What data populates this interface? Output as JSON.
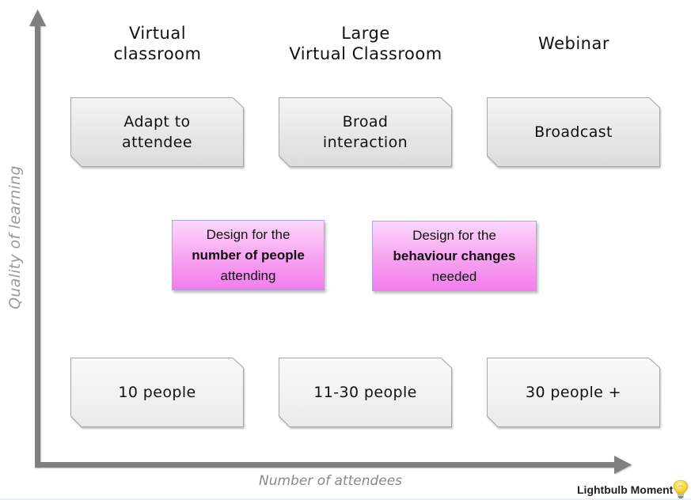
{
  "axes": {
    "y_label": "Quality of learning",
    "x_label": "Number of attendees",
    "axis_color": "#7f7f7f"
  },
  "columns": [
    {
      "title": "Virtual\nclassroom",
      "title_lines": [
        "Virtual",
        "classroom"
      ],
      "quality": "Adapt to\nattendee",
      "quality_lines": [
        "Adapt to",
        "attendee"
      ],
      "attendees": "10 people"
    },
    {
      "title": "Large Virtual Classroom",
      "title_lines": [
        "Large",
        "Virtual Classroom"
      ],
      "quality": "Broad interaction",
      "quality_lines": [
        "Broad",
        "interaction"
      ],
      "attendees": "11-30 people"
    },
    {
      "title": "Webinar",
      "title_lines": [
        "Webinar"
      ],
      "quality": "Broadcast",
      "quality_lines": [
        "Broadcast"
      ],
      "attendees": "30 people +"
    }
  ],
  "callouts": [
    {
      "line1": "Design for the",
      "bold": "number of people",
      "line3": "attending"
    },
    {
      "line1": "Design for the",
      "bold": "behaviour changes",
      "line3": "needed"
    }
  ],
  "brand": {
    "name": "Lightbulb Moment",
    "icon": "lightbulb-icon"
  },
  "colors": {
    "card_fill_top": "#f4f4f4",
    "card_fill_bottom": "#dedede",
    "card_border": "#a6a6a6",
    "callout_top": "#fdd7fb",
    "callout_bottom": "#f27ded",
    "label_gray": "#999999"
  }
}
